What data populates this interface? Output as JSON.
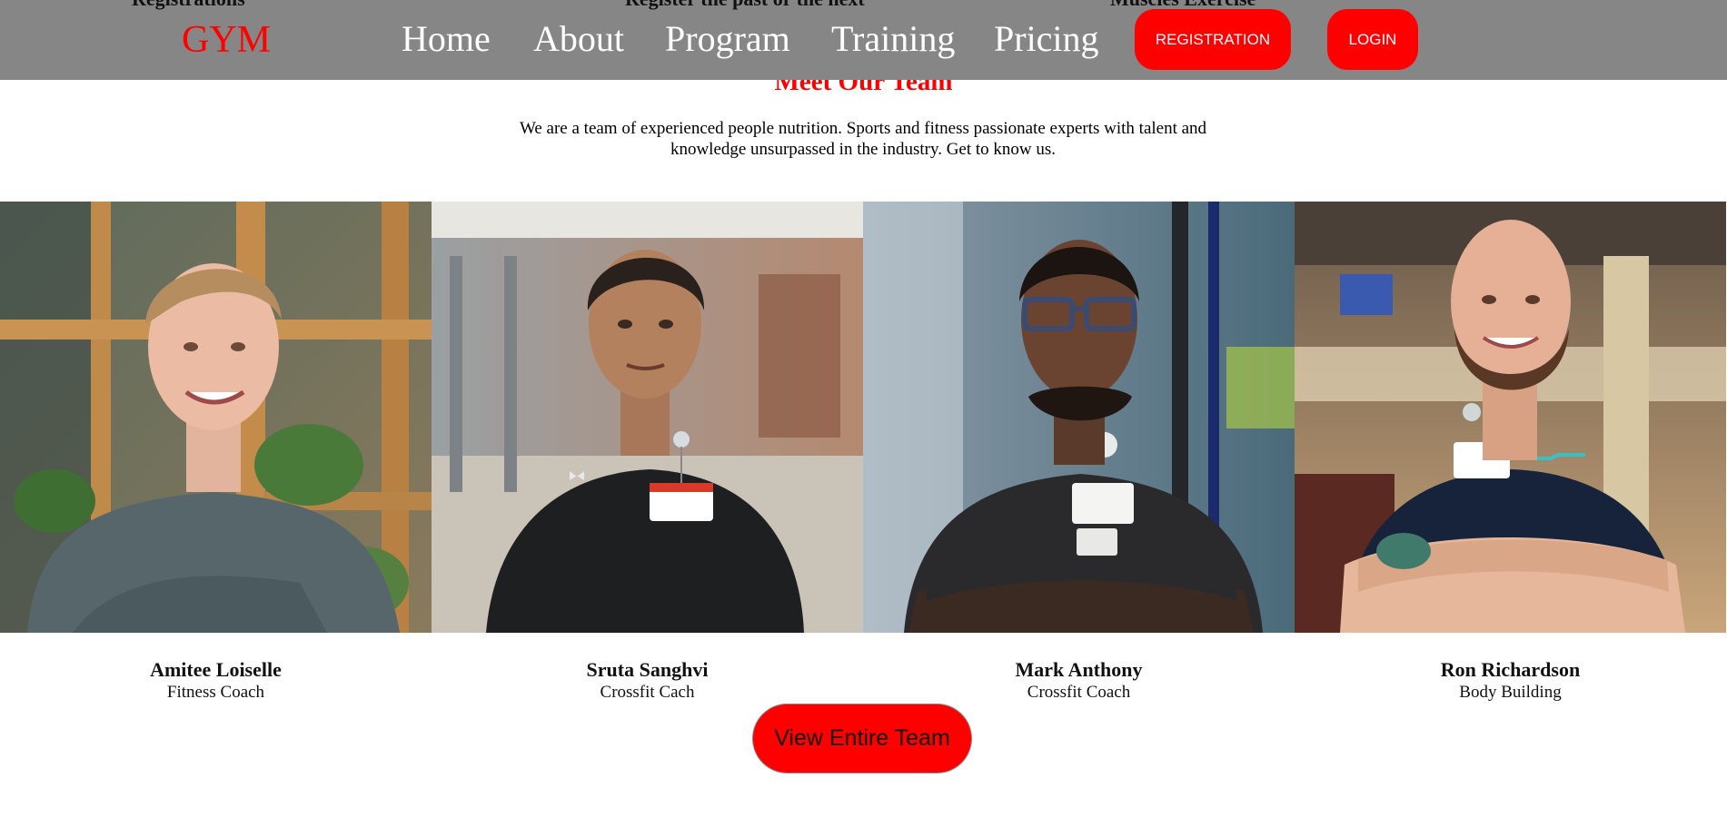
{
  "header": {
    "behind_text": [
      "Registrations",
      "Register the past or the next",
      "Muscles Exercise"
    ],
    "logo": "GYM",
    "nav": [
      "Home",
      "About",
      "Program",
      "Training",
      "Pricing"
    ],
    "registration_button": "REGISTRATION",
    "login_button": "LOGIN"
  },
  "team": {
    "title": "Meet Our Team",
    "intro": "We are a team of experienced people nutrition. Sports and fitness passionate experts with talent and knowledge unsurpassed in the industry. Get to know us.",
    "members": [
      {
        "name": "Amitee Loiselle",
        "role": "Fitness Coach"
      },
      {
        "name": "Sruta Sanghvi",
        "role": "Crossfit Cach"
      },
      {
        "name": "Mark Anthony",
        "role": "Crossfit Coach"
      },
      {
        "name": "Ron Richardson",
        "role": "Body Building"
      }
    ],
    "view_button": "View Entire Team"
  },
  "colors": {
    "accent": "#ff0000",
    "header_bg": "#868686",
    "text": "#111111"
  }
}
